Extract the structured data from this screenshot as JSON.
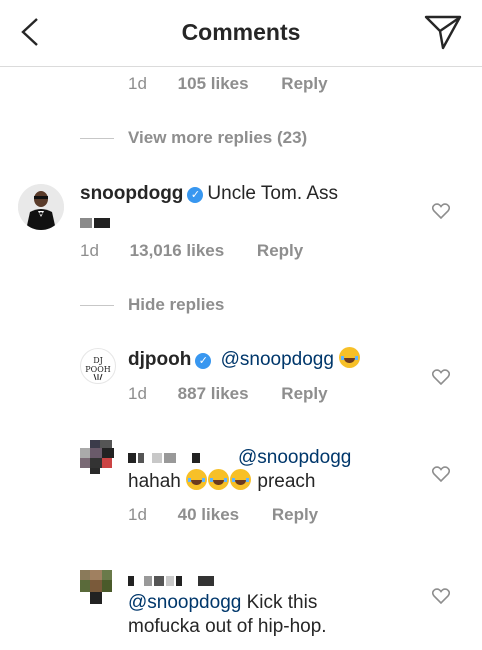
{
  "header": {
    "title": "Comments",
    "back_icon": "chevron-left-icon",
    "send_icon": "paper-plane-icon"
  },
  "top_meta": {
    "time": "1d",
    "likes": "105 likes",
    "reply": "Reply"
  },
  "view_more": "View more replies (23)",
  "snoop": {
    "username": "snoopdogg",
    "text": "Uncle Tom. Ass",
    "time": "1d",
    "likes": "13,016 likes",
    "reply": "Reply"
  },
  "hide_replies": "Hide replies",
  "djpooh": {
    "username": "djpooh",
    "mention": "@snoopdogg",
    "time": "1d",
    "likes": "887 likes",
    "reply": "Reply"
  },
  "reply2": {
    "mention": "@snoopdogg",
    "text1": "hahah",
    "text2": "preach",
    "time": "1d",
    "likes": "40 likes",
    "reply": "Reply"
  },
  "reply3": {
    "mention": "@snoopdogg",
    "text_after_mention": " Kick this",
    "line2": "mofucka out of hip-hop."
  },
  "colors": {
    "link": "#00376b",
    "verified": "#3897f0",
    "meta": "#8e8e8e",
    "divider": "#dbdbdb"
  }
}
